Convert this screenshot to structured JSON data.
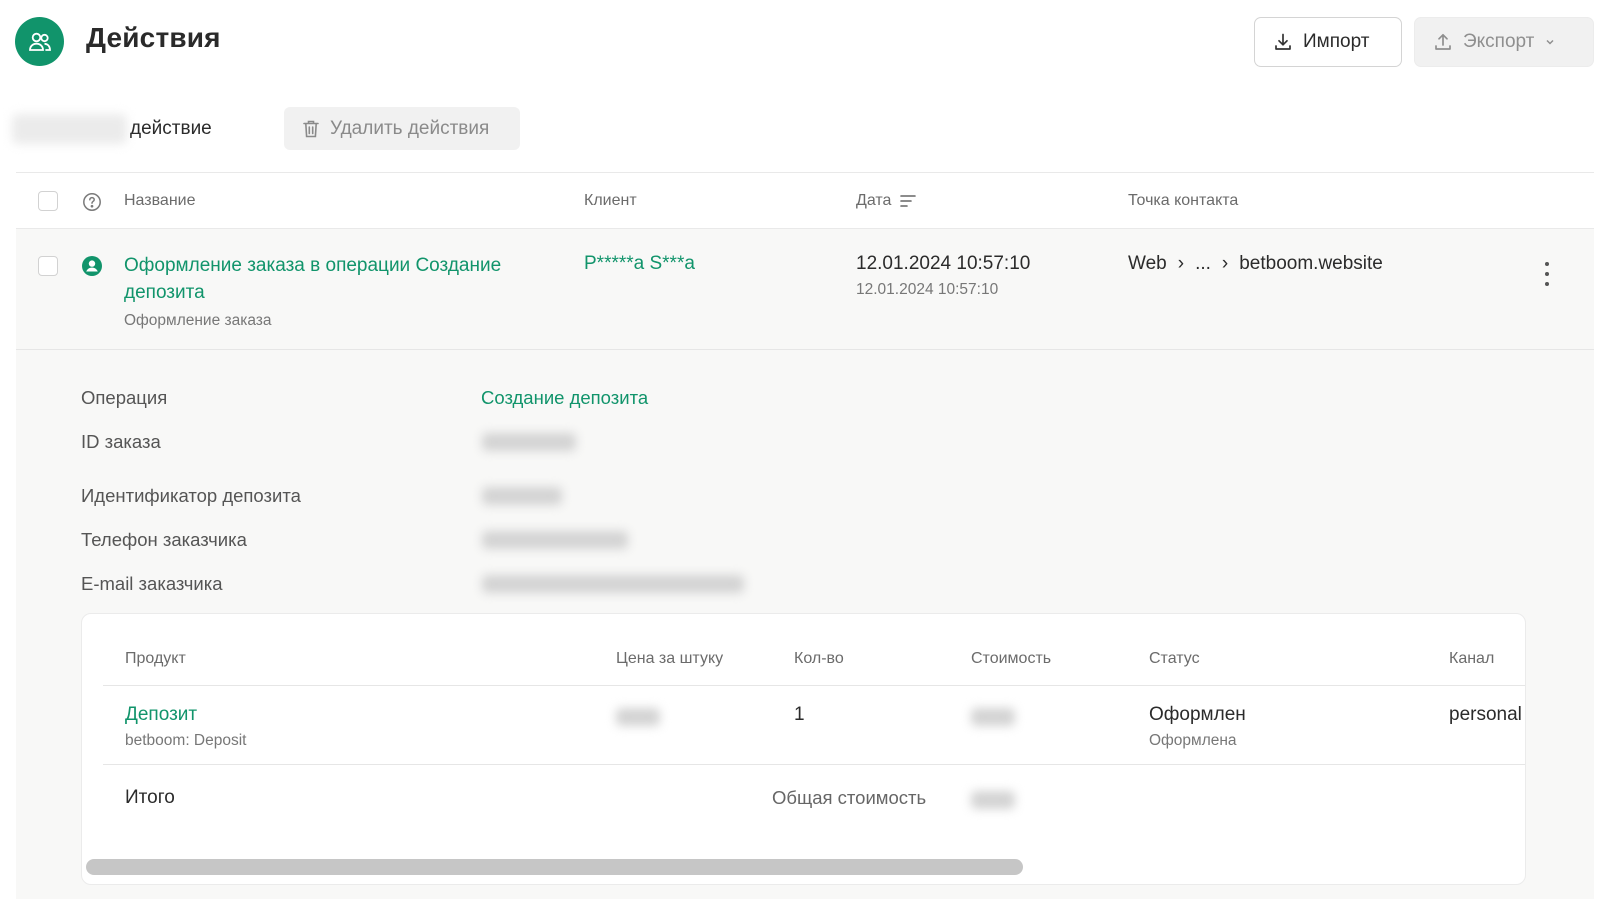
{
  "header": {
    "title": "Действия",
    "import_label": "Импорт",
    "export_label": "Экспорт"
  },
  "toolbar": {
    "action_label": "действие",
    "delete_label": "Удалить действия"
  },
  "table": {
    "columns": {
      "name": "Название",
      "client": "Клиент",
      "date": "Дата",
      "contact_point": "Точка контакта"
    },
    "row": {
      "title": "Оформление заказа в операции Создание депозита",
      "subtitle": "Оформление заказа",
      "client": "P*****a S***a",
      "date_main": "12.01.2024 10:57:10",
      "date_sub": "12.01.2024 10:57:10",
      "contact": {
        "first": "Web",
        "sep1": "›",
        "middle": "...",
        "sep2": "›",
        "last": "betboom.website"
      }
    }
  },
  "details": {
    "operation_label": "Операция",
    "operation_value": "Создание депозита",
    "order_id_label": "ID заказа",
    "deposit_id_label": "Идентификатор депозита",
    "phone_label": "Телефон заказчика",
    "email_label": "E-mail заказчика"
  },
  "products": {
    "columns": {
      "product": "Продукт",
      "unit_price": "Цена за штуку",
      "qty": "Кол-во",
      "cost": "Стоимость",
      "status": "Статус",
      "channel": "Канал"
    },
    "row": {
      "name": "Депозит",
      "sub": "betboom: Deposit",
      "qty": "1",
      "status": "Оформлен",
      "status_sub": "Оформлена",
      "channel": "personal"
    },
    "total_label": "Итого",
    "total_cost_label": "Общая стоимость"
  },
  "colors": {
    "accent": "#11946b"
  }
}
